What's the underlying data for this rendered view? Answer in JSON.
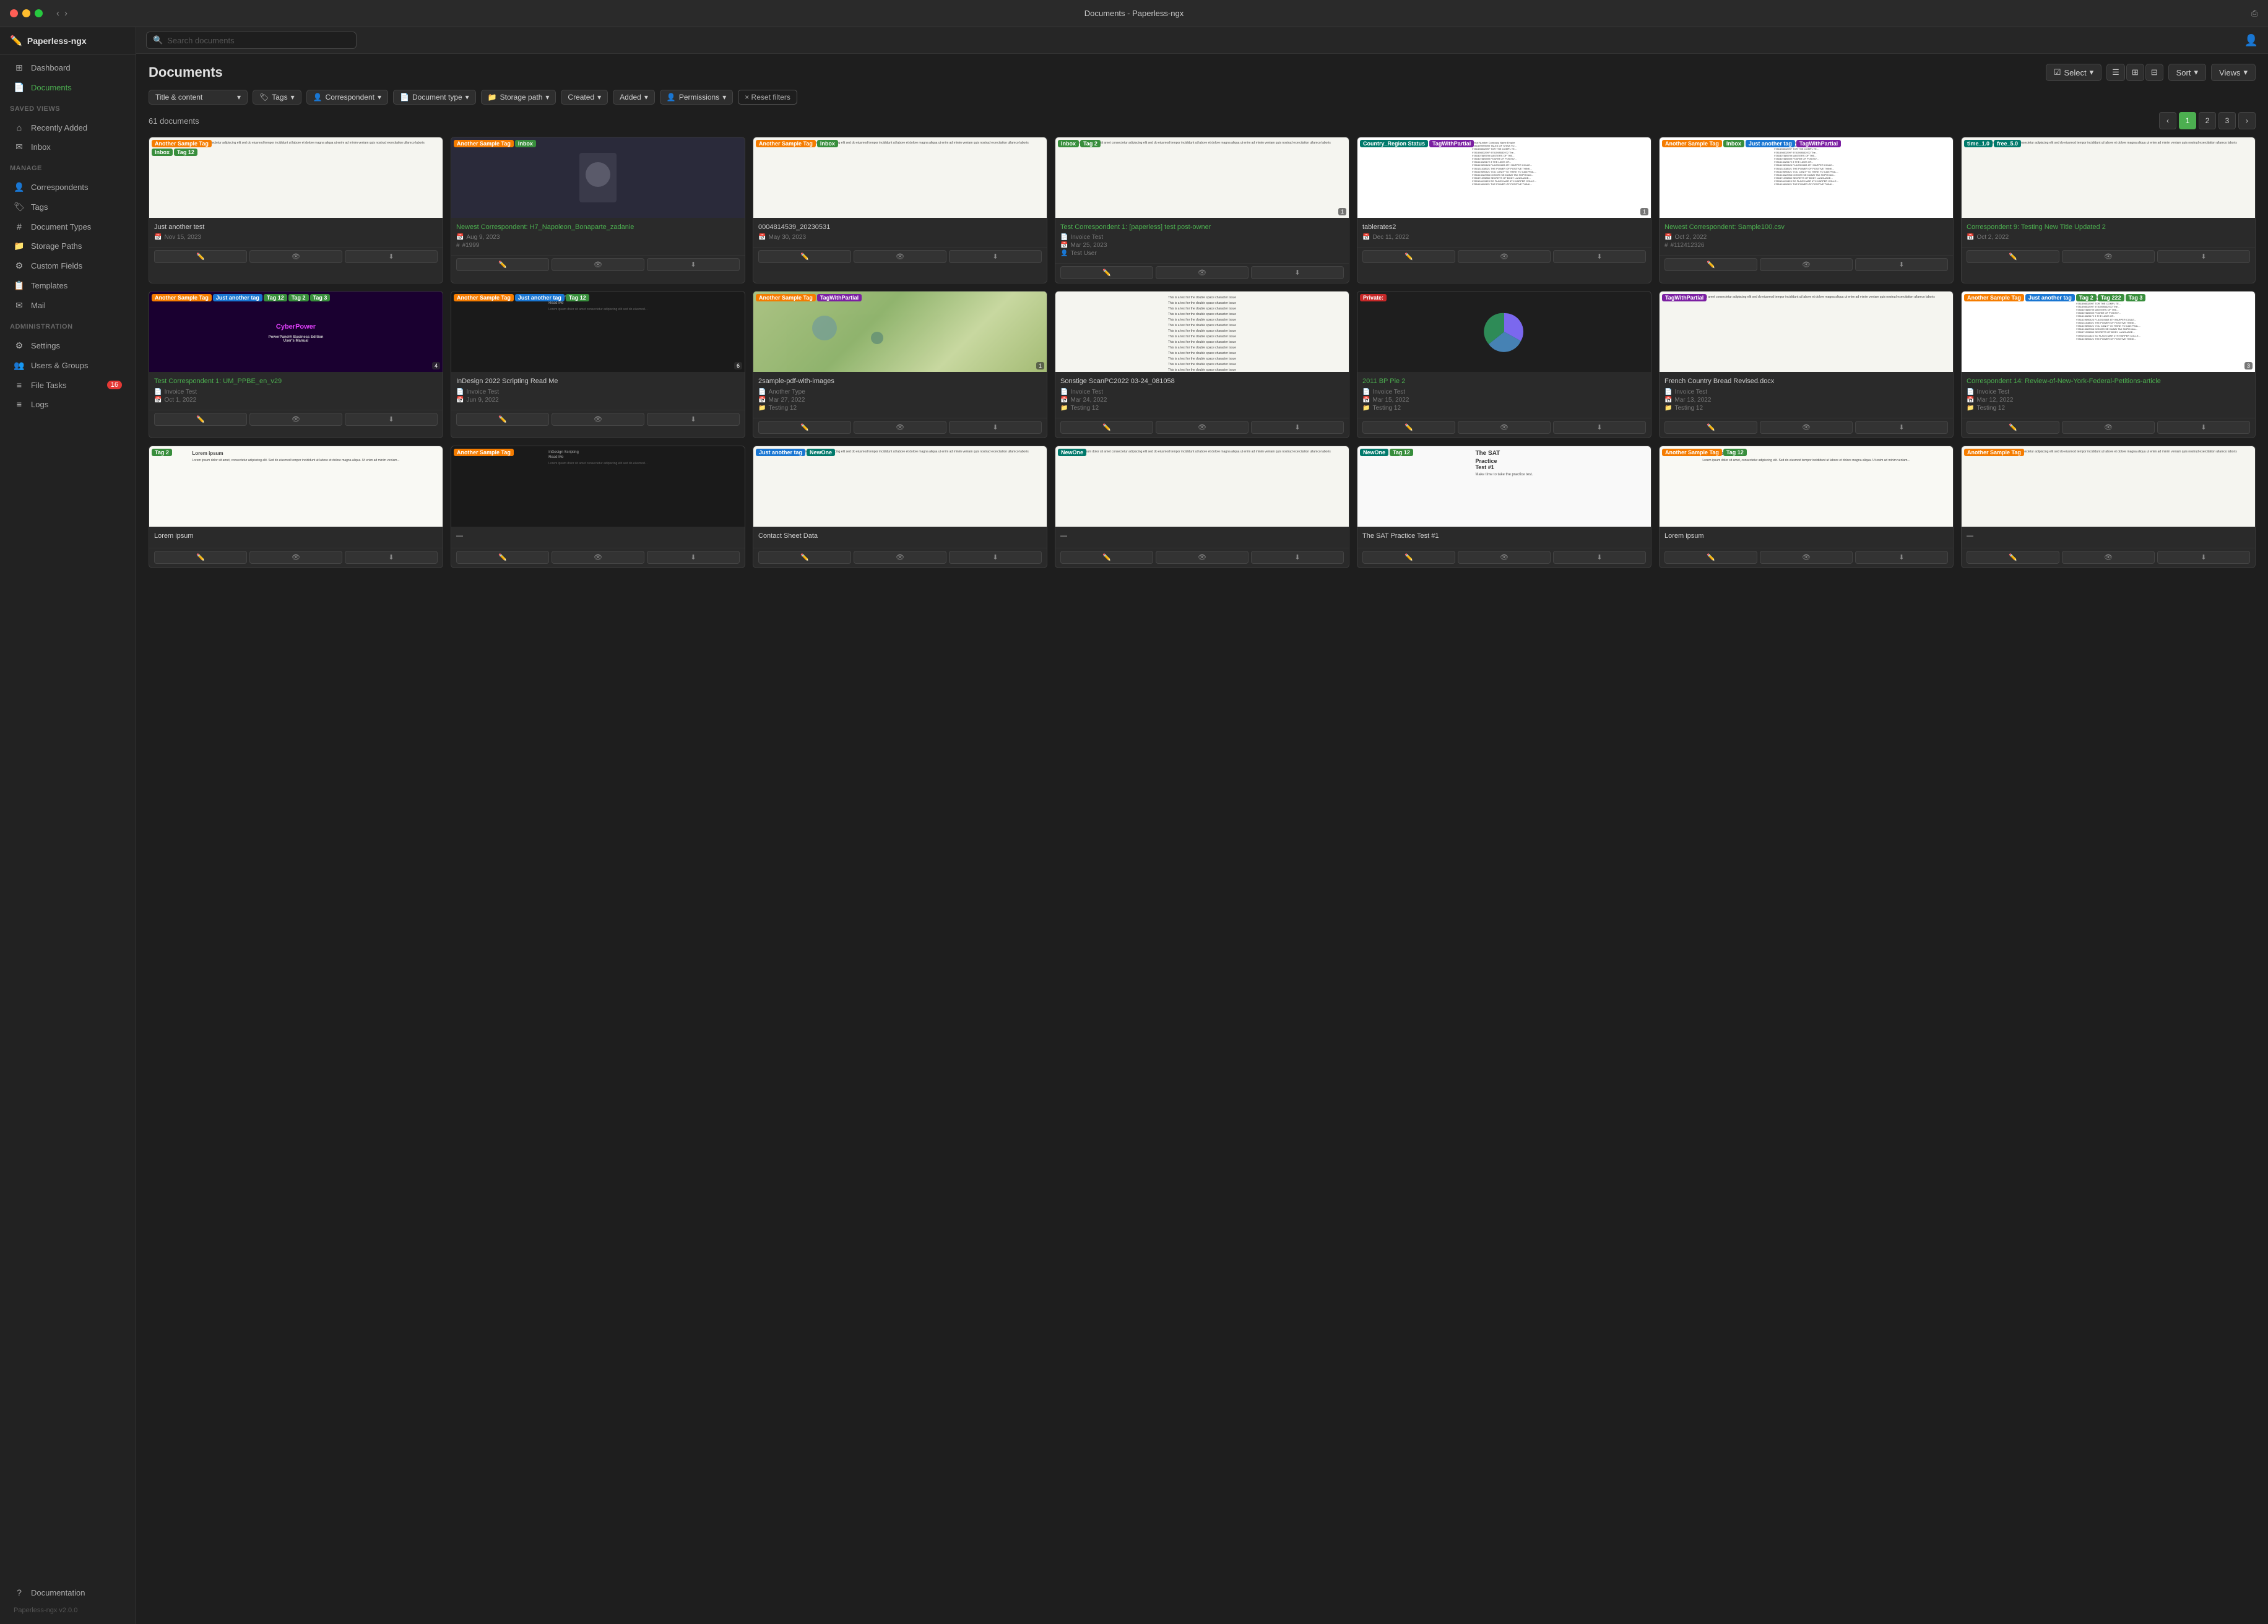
{
  "window": {
    "title": "Documents - Paperless-ngx"
  },
  "sidebar": {
    "app_name": "Paperless-ngx",
    "logo": "✏️",
    "items": [
      {
        "id": "dashboard",
        "label": "Dashboard",
        "icon": "⊞",
        "active": false
      },
      {
        "id": "documents",
        "label": "Documents",
        "icon": "📄",
        "active": true
      }
    ],
    "saved_views_label": "SAVED VIEWS",
    "saved_views": [
      {
        "id": "recently-added",
        "label": "Recently Added",
        "icon": "⌂"
      },
      {
        "id": "inbox",
        "label": "Inbox",
        "icon": "✉"
      }
    ],
    "manage_label": "MANAGE",
    "manage_items": [
      {
        "id": "correspondents",
        "label": "Correspondents",
        "icon": "👤"
      },
      {
        "id": "tags",
        "label": "Tags",
        "icon": "🏷"
      },
      {
        "id": "document-types",
        "label": "Document Types",
        "icon": "#"
      },
      {
        "id": "storage-paths",
        "label": "Storage Paths",
        "icon": "📁"
      },
      {
        "id": "custom-fields",
        "label": "Custom Fields",
        "icon": "⚙"
      },
      {
        "id": "templates",
        "label": "Templates",
        "icon": "📋"
      },
      {
        "id": "mail",
        "label": "Mail",
        "icon": "✉"
      }
    ],
    "admin_label": "ADMINISTRATION",
    "admin_items": [
      {
        "id": "settings",
        "label": "Settings",
        "icon": "⚙"
      },
      {
        "id": "users-groups",
        "label": "Users & Groups",
        "icon": "👥"
      },
      {
        "id": "file-tasks",
        "label": "File Tasks",
        "icon": "≡",
        "badge": "16"
      },
      {
        "id": "logs",
        "label": "Logs",
        "icon": "≡"
      }
    ],
    "footer_items": [
      {
        "id": "documentation",
        "label": "Documentation",
        "icon": "?"
      },
      {
        "id": "version",
        "label": "Paperless-ngx v2.0.0",
        "icon": ""
      }
    ]
  },
  "search": {
    "placeholder": "Search documents"
  },
  "docs": {
    "title": "Documents",
    "count": "61 documents",
    "pagination": {
      "current": 1,
      "pages": [
        "1",
        "2",
        "3"
      ]
    },
    "toolbar": {
      "select_label": "Select",
      "sort_label": "Sort",
      "views_label": "Views",
      "view_list_icon": "☰",
      "view_grid_icon": "⊞",
      "view_detail_icon": "⊟"
    },
    "filters": {
      "title_content": "Title & content",
      "tags": "Tags",
      "correspondent": "Correspondent",
      "document_type": "Document type",
      "storage_path": "Storage path",
      "created": "Created",
      "added": "Added",
      "permissions": "Permissions",
      "reset": "× Reset filters"
    },
    "cards": [
      {
        "id": 1,
        "tags": [
          [
            "Another Sample Tag",
            "orange"
          ]
        ],
        "extra_tags": [
          [
            "Inbox",
            "green"
          ],
          [
            "Tag 12",
            "green"
          ]
        ],
        "title": "Just another test",
        "title_color": "white",
        "date": "Nov 15, 2023",
        "thumb_type": "text"
      },
      {
        "id": 2,
        "tags": [
          [
            "Another Sample Tag",
            "orange"
          ],
          [
            "Inbox",
            "green"
          ]
        ],
        "title": "Newest Correspondent: H7_Napoleon_Bonaparte_zadanie",
        "title_color": "green",
        "date": "Aug 9, 2023",
        "num": "#1999",
        "thumb_type": "portrait"
      },
      {
        "id": 3,
        "tags": [
          [
            "Another Sample Tag",
            "orange"
          ],
          [
            "Inbox",
            "green"
          ]
        ],
        "title": "0004814539_20230531",
        "title_color": "white",
        "date": "May 30, 2023",
        "thumb_type": "text"
      },
      {
        "id": 4,
        "tags": [
          [
            "Inbox",
            "green"
          ],
          [
            "Tag 2",
            "green"
          ]
        ],
        "title": "Test Correspondent 1: [paperless] test post-owner",
        "title_color": "green",
        "doc_type": "Invoice Test",
        "date": "Mar 25, 2023",
        "person": "Test User",
        "thumb_type": "text",
        "num_badge": "1"
      },
      {
        "id": 5,
        "tags": [
          [
            "Country_Region Status",
            "teal"
          ],
          [
            "TagWithPartial",
            "purple"
          ]
        ],
        "title": "tablerates2",
        "title_color": "white",
        "date": "Dec 11, 2022",
        "thumb_type": "dense_text",
        "num_badge": "1"
      },
      {
        "id": 6,
        "tags": [
          [
            "Another Sample Tag",
            "orange"
          ],
          [
            "Inbox",
            "green"
          ],
          [
            "Just another tag",
            "blue"
          ],
          [
            "TagWithPartial",
            "purple"
          ]
        ],
        "title": "Newest Correspondent: Sample100.csv",
        "title_color": "green",
        "date": "Oct 2, 2022",
        "num": "#112412326",
        "thumb_type": "dense_text"
      },
      {
        "id": 7,
        "tags": [
          [
            "time_1.0",
            "teal"
          ],
          [
            "free_5.0",
            "teal"
          ]
        ],
        "title": "Correspondent 9: Testing New Title Updated 2",
        "title_color": "green",
        "date": "Oct 2, 2022",
        "thumb_type": "text"
      },
      {
        "id": 8,
        "tags": [
          [
            "Another Sample Tag",
            "orange"
          ],
          [
            "Just another tag",
            "blue"
          ],
          [
            "Tag 12",
            "green"
          ],
          [
            "Tag 2",
            "green"
          ],
          [
            "Tag 3",
            "green"
          ]
        ],
        "title": "Test Correspondent 1: UM_PPBE_en_v29",
        "title_color": "green",
        "doc_type": "Invoice Test",
        "date": "Oct 1, 2022",
        "num_badge": "4",
        "thumb_type": "cyber"
      },
      {
        "id": 9,
        "tags": [
          [
            "Another Sample Tag",
            "orange"
          ],
          [
            "Just another tag",
            "blue"
          ],
          [
            "Tag 12",
            "green"
          ]
        ],
        "title": "InDesign 2022 Scripting Read Me",
        "title_color": "white",
        "doc_type": "Invoice Test",
        "date": "Jun 9, 2022",
        "num_badge": "6",
        "thumb_type": "dark_text"
      },
      {
        "id": 10,
        "tags": [
          [
            "Another Sample Tag",
            "orange"
          ],
          [
            "TagWithPartial",
            "purple"
          ]
        ],
        "title": "2sample-pdf-with-images",
        "title_color": "white",
        "doc_type": "Another Type",
        "date": "Mar 27, 2022",
        "storage": "Testing 12",
        "num_badge": "1",
        "thumb_type": "map"
      },
      {
        "id": 11,
        "tags": [],
        "title": "Sonstige ScanPC2022 03-24_081058",
        "title_color": "white",
        "doc_type": "Invoice Test",
        "date": "Mar 24, 2022",
        "storage": "Testing 12",
        "thumb_type": "text_lines"
      },
      {
        "id": 12,
        "tags": [
          [
            "Private:",
            "red"
          ]
        ],
        "title": "2011 BP Pie 2",
        "title_color": "green",
        "doc_type": "Invoice Test",
        "date": "Mar 15, 2022",
        "storage": "Testing 12",
        "thumb_type": "pie"
      },
      {
        "id": 13,
        "tags": [
          [
            "TagWithPartial",
            "purple"
          ]
        ],
        "title": "French Country Bread Revised.docx",
        "title_color": "white",
        "doc_type": "Invoice Test",
        "date": "Mar 13, 2022",
        "storage": "Testing 12",
        "thumb_type": "text"
      },
      {
        "id": 14,
        "tags": [
          [
            "Another Sample Tag",
            "orange"
          ],
          [
            "Just another tag",
            "blue"
          ],
          [
            "Tag 2",
            "green"
          ],
          [
            "Tag 222",
            "green"
          ],
          [
            "Tag 3",
            "green"
          ]
        ],
        "title": "Correspondent 14: Review-of-New-York-Federal-Petitions-article",
        "title_color": "green",
        "doc_type": "Invoice Test",
        "date": "Mar 12, 2022",
        "storage": "Testing 12",
        "num_badge": "3",
        "thumb_type": "dense_text2"
      },
      {
        "id": 15,
        "tags": [
          [
            "Tag 2",
            "green"
          ]
        ],
        "title": "Lorem ipsum",
        "title_color": "white",
        "thumb_type": "lorem",
        "date": "—"
      },
      {
        "id": 16,
        "tags": [
          [
            "Another Sample Tag",
            "orange"
          ]
        ],
        "title": "—",
        "title_color": "white",
        "thumb_type": "dark_text",
        "date": "—"
      },
      {
        "id": 17,
        "tags": [
          [
            "Just another tag",
            "blue"
          ],
          [
            "NewOne",
            "teal"
          ]
        ],
        "title": "Contact Sheet Data",
        "title_color": "white",
        "thumb_type": "text",
        "date": "—"
      },
      {
        "id": 18,
        "tags": [
          [
            "NewOne",
            "teal"
          ]
        ],
        "title": "—",
        "title_color": "white",
        "thumb_type": "text",
        "date": "—"
      },
      {
        "id": 19,
        "tags": [
          [
            "NewOne",
            "teal"
          ],
          [
            "Tag 12",
            "green"
          ]
        ],
        "title": "The SAT Practice Test #1",
        "title_color": "white",
        "thumb_type": "sat",
        "date": "—"
      },
      {
        "id": 20,
        "tags": [
          [
            "Another Sample Tag",
            "orange"
          ],
          [
            "Tag 12",
            "green"
          ]
        ],
        "title": "Lorem ipsum",
        "title_color": "white",
        "thumb_type": "lorem2",
        "date": "—"
      },
      {
        "id": 21,
        "tags": [
          [
            "Another Sample Tag",
            "orange"
          ]
        ],
        "title": "—",
        "title_color": "white",
        "thumb_type": "text",
        "date": "—"
      }
    ]
  }
}
